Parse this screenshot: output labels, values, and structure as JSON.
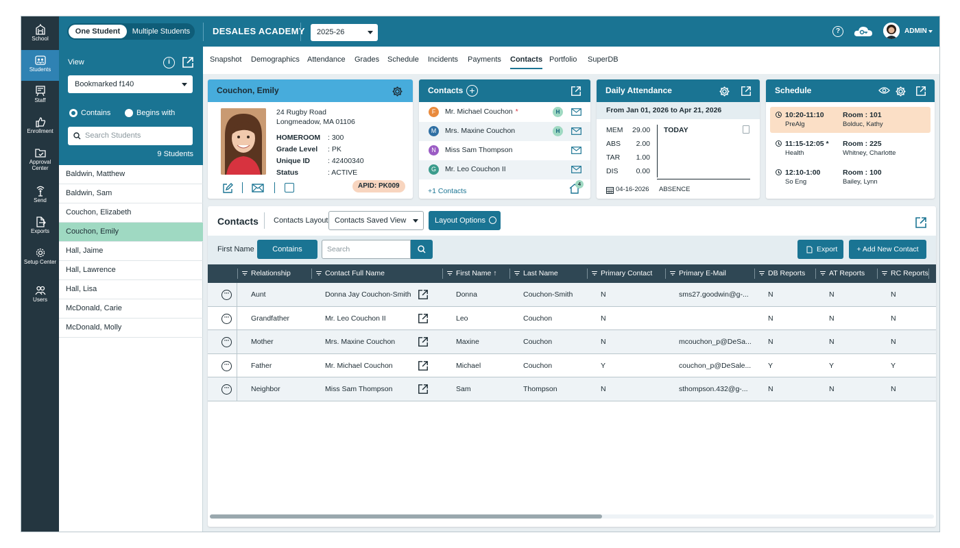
{
  "rail": {
    "items": [
      {
        "label": "School",
        "icon": "school-icon"
      },
      {
        "label": "Students",
        "icon": "students-icon",
        "active": true
      },
      {
        "label": "Staff",
        "icon": "staff-icon"
      },
      {
        "label": "Enrollment",
        "icon": "enrollment-icon"
      },
      {
        "label": "Approval Center",
        "icon": "approval-center-icon"
      },
      {
        "label": "Send",
        "icon": "send-icon"
      },
      {
        "label": "Exports",
        "icon": "exports-icon"
      },
      {
        "label": "Setup Center",
        "icon": "setup-center-icon"
      },
      {
        "label": "Users",
        "icon": "users-icon"
      }
    ]
  },
  "topbar": {
    "mode_one": "One Student",
    "mode_multi": "Multiple Students",
    "school_name": "DESALES ACADEMY",
    "year": "2025-26",
    "user": "ADMIN"
  },
  "left": {
    "view_label": "View",
    "bookmark_select": "Bookmarked f140",
    "radio_contains": "Contains",
    "radio_begins": "Begins with",
    "search_placeholder": "Search Students",
    "count": "9 Students",
    "students": [
      "Baldwin, Matthew",
      "Baldwin, Sam",
      "Couchon, Elizabeth",
      "Couchon, Emily",
      "Hall, Jaime",
      "Hall, Lawrence",
      "Hall, Lisa",
      "McDonald, Carie",
      "McDonald, Molly"
    ],
    "selected_index": 3
  },
  "tabs": [
    "Snapshot",
    "Demographics",
    "Attendance",
    "Grades",
    "Schedule",
    "Incidents",
    "Payments",
    "Contacts",
    "Portfolio",
    "SuperDB"
  ],
  "active_tab": "Contacts",
  "student_card": {
    "name": "Couchon, Emily",
    "address1": "24 Rugby Road",
    "address2": "Longmeadow, MA 01106",
    "fields": [
      {
        "k": "HOMEROOM",
        "v": ": 300"
      },
      {
        "k": "Grade Level",
        "v": ": PK"
      },
      {
        "k": "Unique ID",
        "v": ": 42400340"
      },
      {
        "k": "Status",
        "v": ": ACTIVE"
      }
    ],
    "apid_label": "APID:",
    "apid_value": "PK009"
  },
  "contacts_card": {
    "title": "Contacts",
    "items": [
      {
        "initial": "F",
        "color": "#e98a3c",
        "name": "Mr. Michael Couchon",
        "required": "*",
        "home": "H"
      },
      {
        "initial": "M",
        "color": "#2f6fa3",
        "name": "Mrs. Maxine Couchon",
        "required": "",
        "home": "H"
      },
      {
        "initial": "N",
        "color": "#9b5cc4",
        "name": "Miss Sam Thompson",
        "required": "",
        "home": ""
      },
      {
        "initial": "G",
        "color": "#3b9c8c",
        "name": "Mr. Leo Couchon II",
        "required": "",
        "home": ""
      }
    ],
    "more": "+1 Contacts",
    "household_count": "4"
  },
  "attendance_card": {
    "title": "Daily Attendance",
    "range": "From Jan 01, 2026 to Apr 21, 2026",
    "stats": [
      {
        "k": "MEM",
        "v": "29.00"
      },
      {
        "k": "ABS",
        "v": "2.00"
      },
      {
        "k": "TAR",
        "v": "1.00"
      },
      {
        "k": "DIS",
        "v": "0.00"
      }
    ],
    "today": "TODAY",
    "date": "04-16-2026",
    "event": "ABSENCE"
  },
  "schedule_card": {
    "title": "Schedule",
    "items": [
      {
        "time": "10:20-11:10",
        "course": "PreAlg",
        "room": "Room : 101",
        "teacher": "Bolduc, Kathy",
        "current": true
      },
      {
        "time": "11:15-12:05 *",
        "course": "Health",
        "room": "Room : 225",
        "teacher": "Whitney, Charlotte",
        "current": false
      },
      {
        "time": "12:10-1:00",
        "course": "So Eng",
        "room": "Room : 100",
        "teacher": "Bailey, Lynn",
        "current": false
      }
    ]
  },
  "contacts_panel": {
    "title": "Contacts",
    "layout_label": "Contacts Layout",
    "layout_select": "Contacts Saved View",
    "layout_options": "Layout Options",
    "filter_label": "First Name",
    "filter_mode": "Contains",
    "search_placeholder": "Search",
    "export": "Export",
    "add": "+ Add New Contact",
    "columns": [
      "Relationship",
      "Contact Full Name",
      "First Name ↑",
      "Last Name",
      "Primary Contact",
      "Primary E-Mail",
      "DB Reports",
      "AT Reports",
      "RC Reports"
    ],
    "rows": [
      {
        "relationship": "Aunt",
        "full_name": "Donna Jay Couchon-Smith",
        "first": "Donna",
        "last": "Couchon-Smith",
        "primary": "N",
        "email": "sms27.goodwin@g-...",
        "db": "N",
        "at": "N",
        "rc": "N"
      },
      {
        "relationship": "Grandfather",
        "full_name": "Mr. Leo Couchon II",
        "first": "Leo",
        "last": "Couchon",
        "primary": "N",
        "email": "",
        "db": "N",
        "at": "N",
        "rc": "N"
      },
      {
        "relationship": "Mother",
        "full_name": "Mrs. Maxine Couchon",
        "first": "Maxine",
        "last": "Couchon",
        "primary": "N",
        "email": "mcouchon_p@DeSa...",
        "db": "N",
        "at": "N",
        "rc": "N"
      },
      {
        "relationship": "Father",
        "full_name": "Mr. Michael Couchon",
        "first": "Michael",
        "last": "Couchon",
        "primary": "Y",
        "email": "couchon_p@DeSale...",
        "db": "Y",
        "at": "Y",
        "rc": "Y"
      },
      {
        "relationship": "Neighbor",
        "full_name": "Miss Sam Thompson",
        "first": "Sam",
        "last": "Thompson",
        "primary": "N",
        "email": "sthompson.432@g-...",
        "db": "N",
        "at": "N",
        "rc": "N"
      }
    ]
  },
  "colors": {
    "primary": "#1a7493",
    "rail": "#243640",
    "selected_row": "#9fd9c2",
    "highlight": "#fbdfc6"
  }
}
